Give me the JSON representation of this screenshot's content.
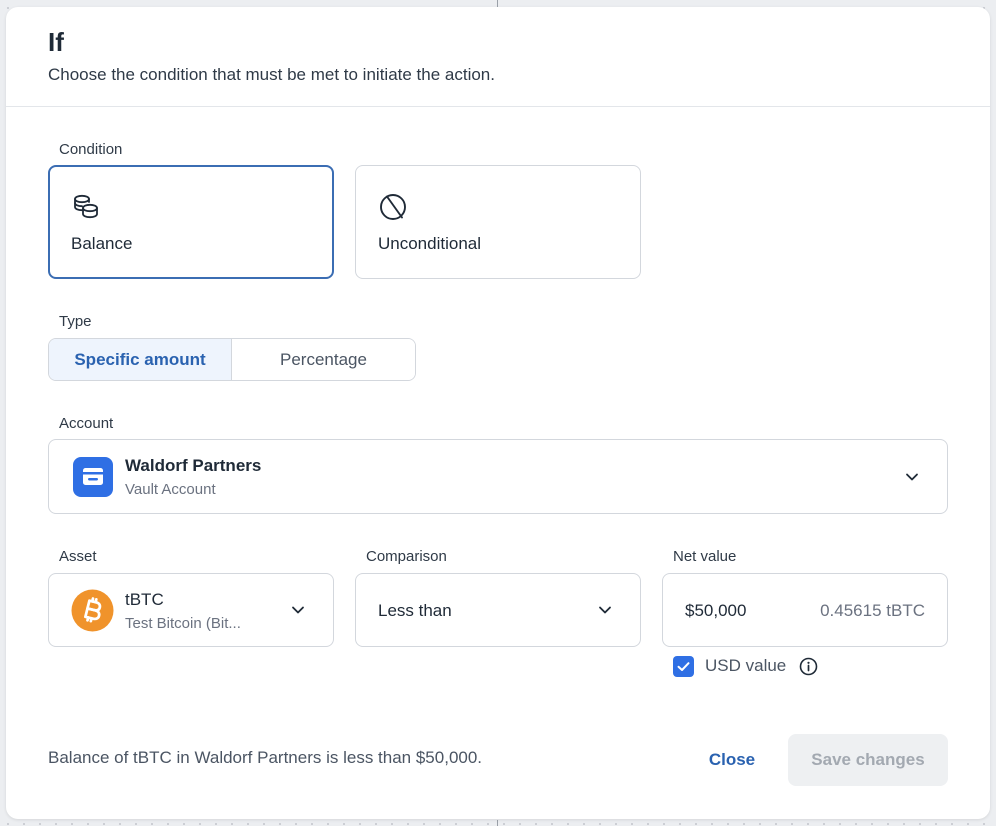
{
  "dialog": {
    "title": "If",
    "subtitle": "Choose the condition that must be met to initiate the action."
  },
  "condition": {
    "label": "Condition",
    "options": [
      {
        "label": "Balance",
        "icon": "coins-icon",
        "selected": true
      },
      {
        "label": "Unconditional",
        "icon": "circle-slash-icon",
        "selected": false
      }
    ]
  },
  "type": {
    "label": "Type",
    "options": [
      {
        "label": "Specific amount",
        "active": true
      },
      {
        "label": "Percentage",
        "active": false
      }
    ]
  },
  "account": {
    "label": "Account",
    "name": "Waldorf Partners",
    "subtitle": "Vault Account",
    "icon": "vault-card-icon"
  },
  "asset": {
    "label": "Asset",
    "symbol": "tBTC",
    "name": "Test Bitcoin (Bit...",
    "icon": "bitcoin-icon"
  },
  "comparison": {
    "label": "Comparison",
    "value": "Less than"
  },
  "net_value": {
    "label": "Net value",
    "usd": "$50,000",
    "converted": "0.45615 tBTC",
    "usd_toggle_label": "USD value",
    "usd_toggle_checked": true
  },
  "footer": {
    "summary": "Balance of tBTC in Waldorf Partners is less than $50,000.",
    "close_label": "Close",
    "save_label": "Save changes"
  },
  "colors": {
    "accent": "#2a62b0",
    "selected_border": "#3b6db3",
    "checkbox": "#2f6fe4",
    "bitcoin": "#f0932b",
    "disabled_bg": "#eef0f2",
    "disabled_text": "#a3a9b1"
  }
}
